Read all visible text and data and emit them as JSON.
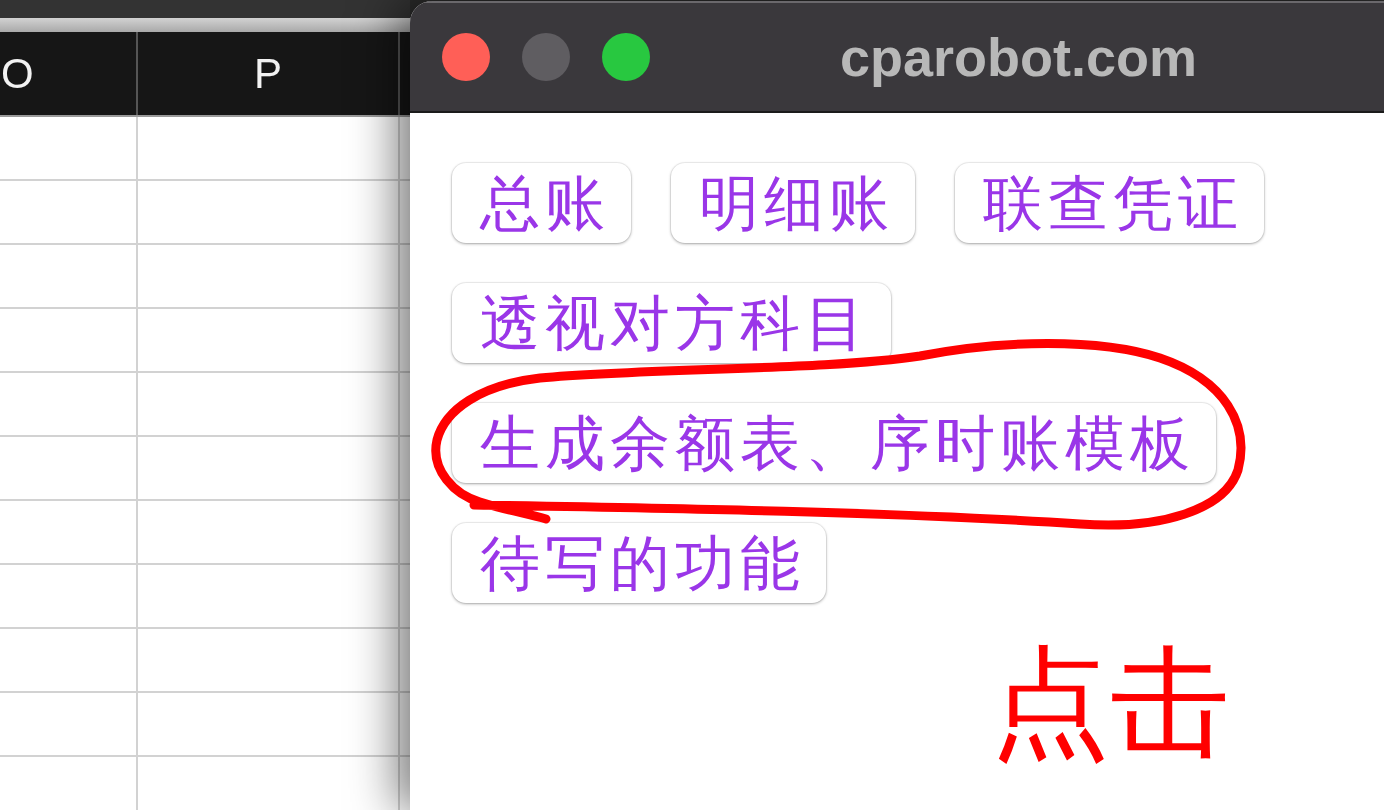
{
  "spreadsheet": {
    "columns": [
      "O",
      "P"
    ]
  },
  "window": {
    "controls": [
      {
        "kind": "close",
        "disabled": false
      },
      {
        "kind": "minimize",
        "disabled": true
      },
      {
        "kind": "zoom",
        "disabled": false
      }
    ],
    "title": "cparobot.com",
    "buttons": [
      "总账",
      "明细账",
      "联查凭证",
      "透视对方科目",
      "生成余额表、序时账模板",
      "待写的功能"
    ]
  },
  "annotation": {
    "text": "点击"
  }
}
